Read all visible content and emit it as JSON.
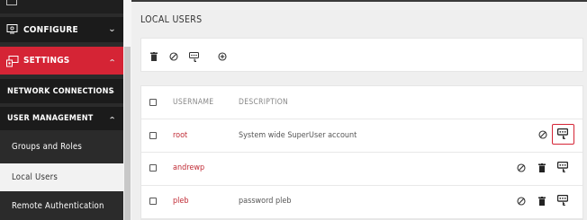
{
  "sidebar": {
    "configure": "CONFIGURE",
    "settings": "SETTINGS",
    "network_connections": "NETWORK CONNECTIONS",
    "user_management": "USER MANAGEMENT",
    "groups_and_roles": "Groups and Roles",
    "local_users": "Local Users",
    "remote_authentication": "Remote Authentication",
    "chevron_down": "v",
    "chevron_up": "^"
  },
  "page": {
    "title": "LOCAL USERS"
  },
  "table": {
    "headers": {
      "username": "USERNAME",
      "description": "DESCRIPTION"
    },
    "rows": [
      {
        "username": "root",
        "description": "System wide SuperUser account"
      },
      {
        "username": "andrewp",
        "description": ""
      },
      {
        "username": "pleb",
        "description": "password pleb"
      }
    ]
  },
  "colors": {
    "accent": "#d52435",
    "sidebar_bg": "#2b2b2b",
    "link": "#c02a34"
  },
  "icons": [
    "trash-icon",
    "disable-icon",
    "change-password-icon",
    "add-icon"
  ]
}
